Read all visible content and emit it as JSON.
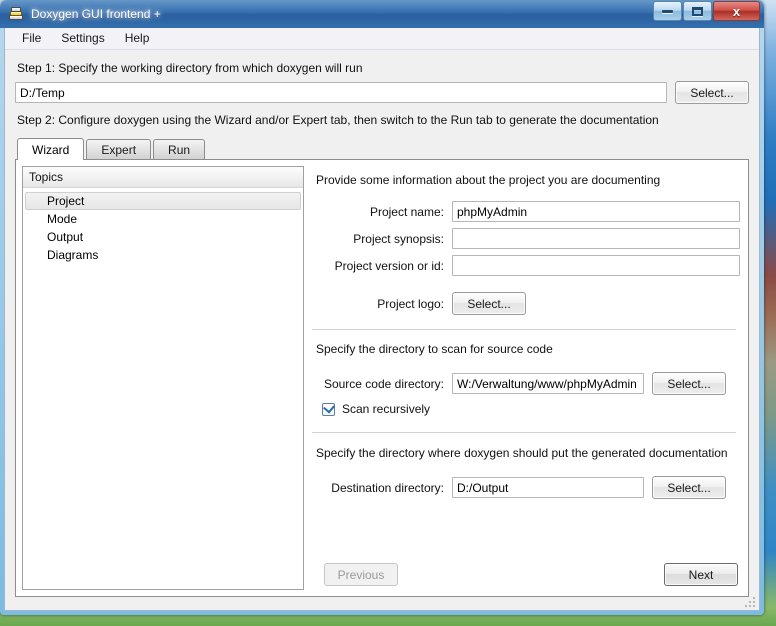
{
  "window": {
    "title": "Doxygen GUI frontend +",
    "icon": "doxygen-stack-icon",
    "controls": {
      "minimize": "–",
      "maximize": "□",
      "close": "x"
    },
    "title_bar_color": "#2f6aab",
    "close_button_color": "#ab2f26"
  },
  "menubar": {
    "items": [
      {
        "label": "File"
      },
      {
        "label": "Settings"
      },
      {
        "label": "Help"
      }
    ]
  },
  "steps": {
    "step1_label": "Step 1: Specify the working directory from which doxygen will run",
    "working_directory": "D:/Temp",
    "working_directory_placeholder": "",
    "step1_select_button": "Select...",
    "step2_label": "Step 2: Configure doxygen using the Wizard and/or Expert tab, then switch to the Run tab to generate the documentation"
  },
  "tabs": [
    {
      "label": "Wizard",
      "active": true
    },
    {
      "label": "Expert",
      "active": false
    },
    {
      "label": "Run",
      "active": false
    }
  ],
  "topics": {
    "header": "Topics",
    "items": [
      {
        "label": "Project",
        "selected": true
      },
      {
        "label": "Mode",
        "selected": false
      },
      {
        "label": "Output",
        "selected": false
      },
      {
        "label": "Diagrams",
        "selected": false
      }
    ]
  },
  "wizard": {
    "project_section_text": "Provide some information about the project you are documenting",
    "fields": {
      "project_name_label": "Project name:",
      "project_name_value": "phpMyAdmin",
      "project_synopsis_label": "Project synopsis:",
      "project_synopsis_value": "",
      "project_version_label": "Project version or id:",
      "project_version_value": "",
      "project_logo_label": "Project logo:",
      "project_logo_button": "Select..."
    },
    "source_section_text": "Specify the directory to scan for source code",
    "source_directory_label": "Source code directory:",
    "source_directory_value": "W:/Verwaltung/www/phpMyAdmin",
    "source_select_button": "Select...",
    "scan_recursively_label": "Scan recursively",
    "scan_recursively_checked": true,
    "destination_section_text": "Specify the directory where doxygen should put the generated documentation",
    "destination_directory_label": "Destination directory:",
    "destination_directory_value": "D:/Output",
    "destination_select_button": "Select...",
    "previous_button": "Previous",
    "previous_button_enabled": false,
    "next_button": "Next",
    "next_button_enabled": true
  }
}
